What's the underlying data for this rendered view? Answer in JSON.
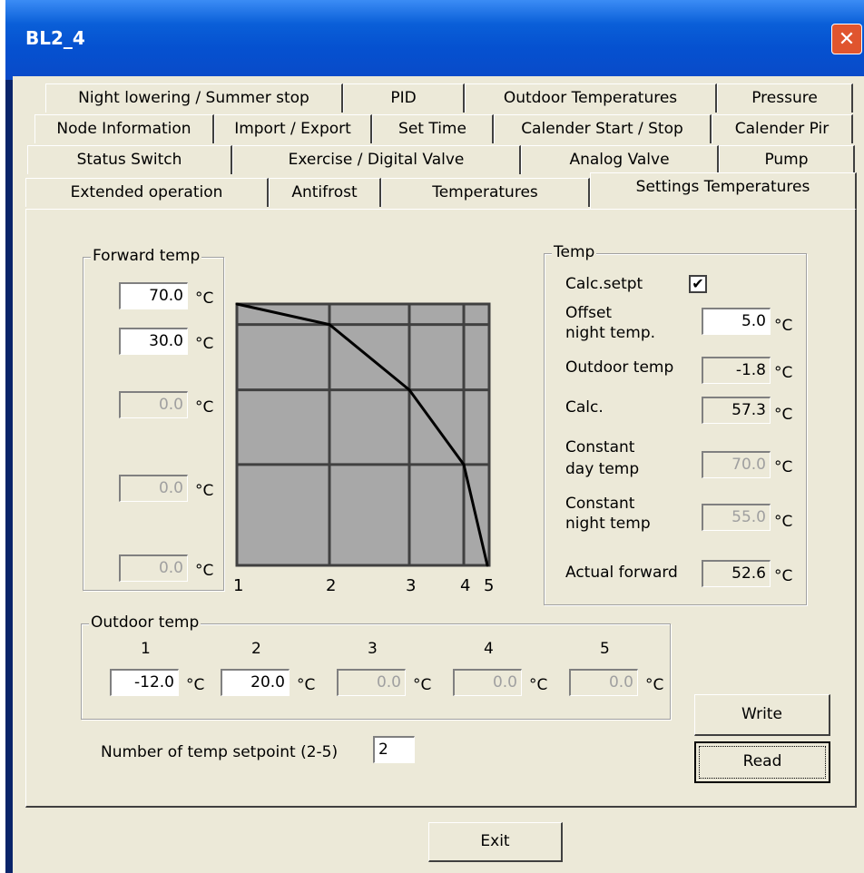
{
  "window": {
    "title": "BL2_4",
    "close_icon": "close-icon"
  },
  "tabs": {
    "row1": [
      "Night lowering / Summer stop",
      "PID",
      "Outdoor Temperatures",
      "Pressure"
    ],
    "row2": [
      "Node Information",
      "Import / Export",
      "Set Time",
      "Calender Start / Stop",
      "Calender Pir"
    ],
    "row3": [
      "Status Switch",
      "Exercise / Digital Valve",
      "Analog Valve",
      "Pump"
    ],
    "row4": [
      "Extended operation",
      "Antifrost",
      "Temperatures",
      "Settings Temperatures"
    ]
  },
  "forward_temp": {
    "legend": "Forward temp",
    "unit": "°C",
    "values": [
      "70.0",
      "30.0",
      "0.0",
      "0.0",
      "0.0"
    ]
  },
  "chart_data": {
    "type": "line",
    "x": [
      1,
      2,
      3,
      4,
      5
    ],
    "x_tick_labels": [
      "1",
      "2",
      "3",
      "4",
      "5"
    ],
    "series": [
      {
        "values": [
          70.0,
          64.5,
          47.0,
          27.0,
          0.0
        ]
      }
    ],
    "ylim": [
      0,
      70
    ],
    "grid": true,
    "plot_bg": "#a8a8a8",
    "line_color": "#000000"
  },
  "temp": {
    "legend": "Temp",
    "calc_setpt_label": "Calc.setpt",
    "calc_setpt_checked": "✔",
    "offset_label_1": "Offset",
    "offset_label_2": "night temp.",
    "offset_value": "5.0",
    "outdoor_label": "Outdoor temp",
    "outdoor_value": "-1.8",
    "calc_label": "Calc.",
    "calc_value": "57.3",
    "const_day_label_1": "Constant",
    "const_day_label_2": "day temp",
    "const_day_value": "70.0",
    "const_night_label_1": "Constant",
    "const_night_label_2": "night temp",
    "const_night_value": "55.0",
    "actual_label": "Actual forward",
    "actual_value": "52.6",
    "unit": "°C"
  },
  "outdoor_temp": {
    "legend": "Outdoor temp",
    "headers": [
      "1",
      "2",
      "3",
      "4",
      "5"
    ],
    "values": [
      "-12.0",
      "20.0",
      "0.0",
      "0.0",
      "0.0"
    ],
    "unit": "°C"
  },
  "setpoint": {
    "label": "Number of temp setpoint (2-5)",
    "value": "2"
  },
  "buttons": {
    "write": "Write",
    "read": "Read",
    "exit": "Exit"
  }
}
